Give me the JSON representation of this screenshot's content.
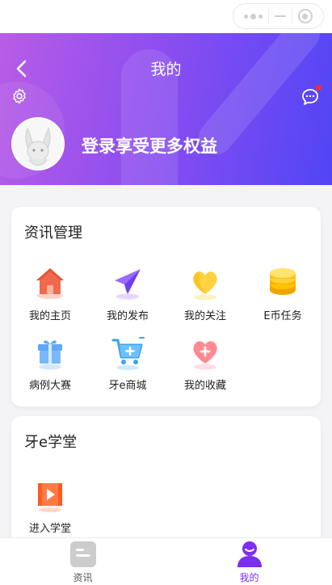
{
  "header": {
    "title": "我的",
    "login_prompt": "登录享受更多权益",
    "gradient": [
      "#b85ce6",
      "#5145f5"
    ],
    "notification_dot_color": "#ff2a2a"
  },
  "info_management": {
    "title": "资讯管理",
    "items": [
      {
        "label": "我的主页",
        "icon": "home-icon"
      },
      {
        "label": "我的发布",
        "icon": "paper-plane-icon"
      },
      {
        "label": "我的关注",
        "icon": "heart-icon"
      },
      {
        "label": "E币任务",
        "icon": "coins-icon"
      },
      {
        "label": "病例大赛",
        "icon": "gift-icon"
      },
      {
        "label": "牙e商城",
        "icon": "shopping-cart-icon"
      },
      {
        "label": "我的收藏",
        "icon": "favorite-heart-icon"
      }
    ]
  },
  "academy": {
    "title": "牙e学堂",
    "items": [
      {
        "label": "进入学堂",
        "icon": "video-play-icon"
      }
    ]
  },
  "tabbar": {
    "tabs": [
      {
        "label": "资讯",
        "icon": "news-icon",
        "active": false
      },
      {
        "label": "我的",
        "icon": "user-icon",
        "active": true
      }
    ],
    "active_color": "#7b2ff0",
    "inactive_color": "#555555"
  }
}
